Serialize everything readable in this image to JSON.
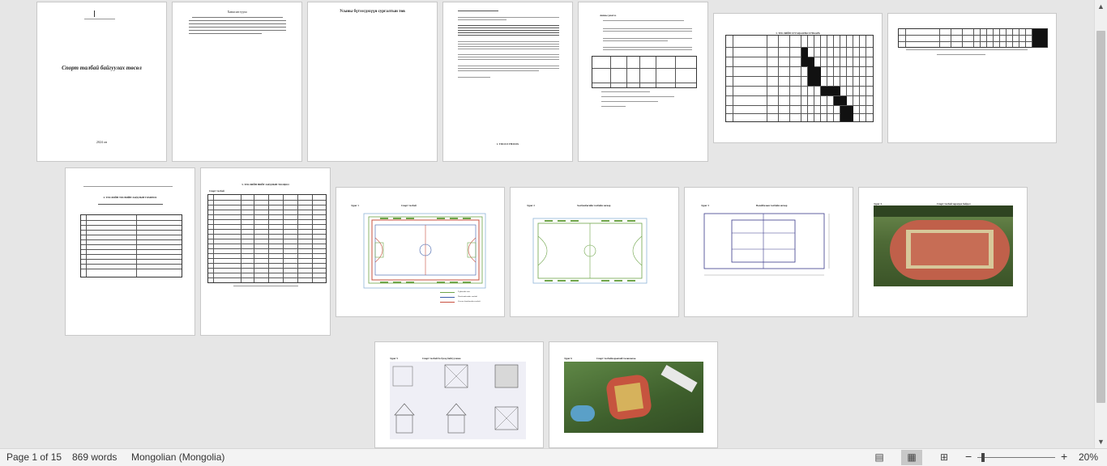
{
  "document": {
    "cover_title": "Спорт талбай байгуулах төсөл",
    "cover_year": "2024 он",
    "page3_heading": "Усыны бүтээгдэхүүн сургалтын төв",
    "page2_heading": "Ханасан тууш",
    "page4_footer": "1. ТӨСӨЛ ҮНЭЛЭХ",
    "page5_heading": "Анхны үнэлгээ",
    "gantt_title": "3. ТӨСЛИЙН ХУГАЦААНЫ ХУВААРЬ",
    "budget_heading": "4. ТӨСЛИЙН ТӨСВИЙН ЗАРДЛЫН ТОХИРОХ",
    "cost_heading": "5. ТӨСЛИЙН НИЙТ ЗАРДЛЫН ТООЦОО",
    "cost_subheading": "Спорт талбай",
    "fig1_label": "Зураг 1",
    "fig1_title": "Спорт талбай",
    "fig2_label": "Зураг 2",
    "fig2_title": "Хөлбөмбөгийн талбайн загвар",
    "fig3_label": "Зураг 3",
    "fig3_title": "Волейболын талбайн загвар",
    "fig4_label": "Зураг 4",
    "fig4_title": "Спорт талбай харагдах байдал",
    "fig5_label": "Зураг 5",
    "fig5_title": "Спорт талбай ба бусад байгууламж",
    "fig6_label": "Зураг 6",
    "fig6_title": "Спорт талбайн ерөнхий төлөвлөгөө",
    "legend_1": "Гүйлтийн зам",
    "legend_2": "Хөлбөмбөгийн талбай",
    "legend_3": "Сагсан бөмбөгийн талбай"
  },
  "status": {
    "page_info": "Page 1 of 15",
    "word_count": "869 words",
    "language": "Mongolian (Mongolia)",
    "zoom_level": "20%",
    "zoom_minus": "−",
    "zoom_plus": "+"
  },
  "colors": {
    "track_red": "#b8503f",
    "field_green": "#6fa54a",
    "plan_blue": "#3b5ca8"
  }
}
